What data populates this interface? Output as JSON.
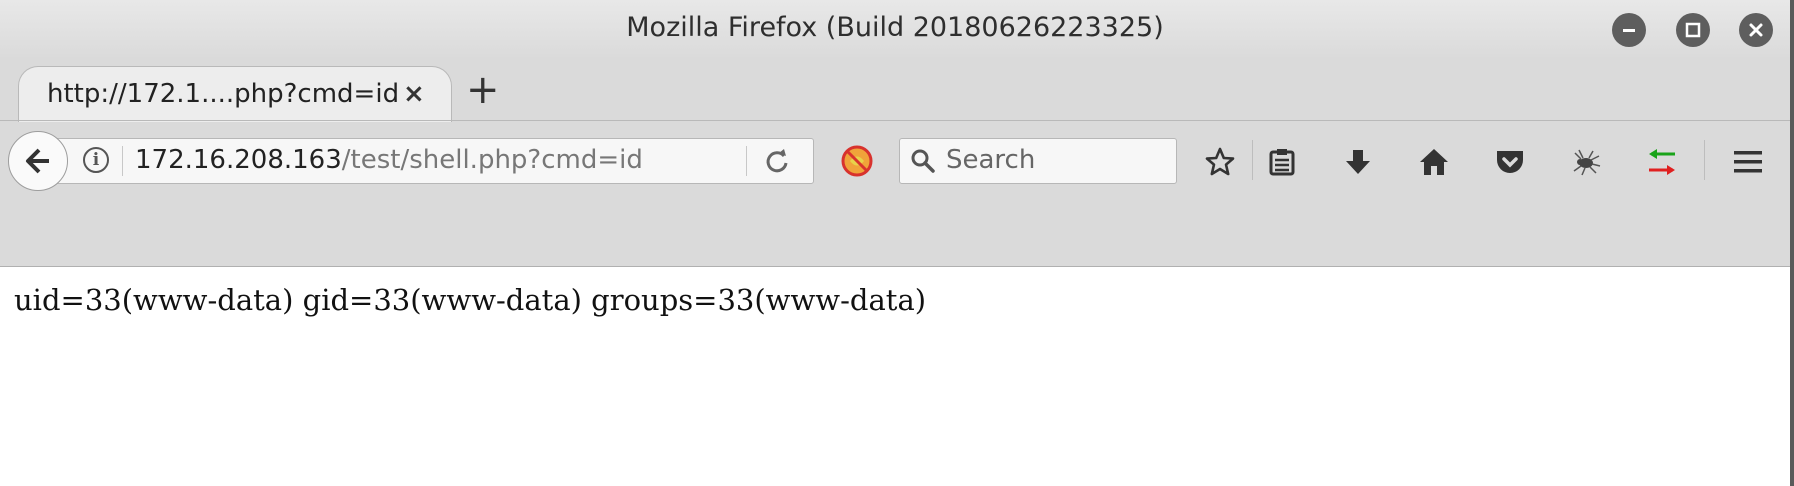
{
  "window": {
    "title": "Mozilla Firefox (Build 20180626223325)"
  },
  "tabs": [
    {
      "label": "http://172.1....php?cmd=id",
      "active": true
    }
  ],
  "navbar": {
    "url_host": "172.16.208.163",
    "url_path": "/test/shell.php?cmd=id",
    "search_placeholder": "Search"
  },
  "icons": {
    "back": "back-arrow-icon",
    "site_info": "info-icon",
    "reload": "reload-icon",
    "noscript": "noscript-icon",
    "search": "search-icon",
    "bookmark": "star-icon",
    "reader": "reading-list-icon",
    "downloads": "download-icon",
    "home": "home-icon",
    "pocket": "pocket-icon",
    "extension": "spider-icon",
    "proxy": "proxy-switch-icon",
    "menu": "hamburger-menu-icon"
  },
  "page": {
    "body_text": "uid=33(www-data) gid=33(www-data) groups=33(www-data)"
  },
  "colors": {
    "window_button": "#5e5e5e",
    "toolbar_bg": "#dadada",
    "noscript_red": "#d8322d",
    "noscript_orange": "#f0a33a",
    "proxy_green": "#19a319",
    "proxy_red": "#e02020"
  }
}
